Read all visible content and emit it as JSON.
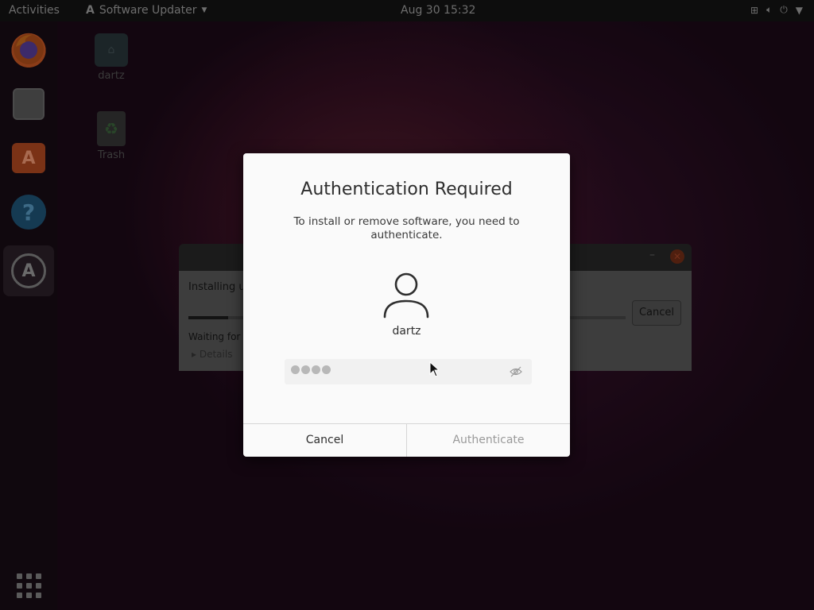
{
  "topbar": {
    "activities": "Activities",
    "app_name": "Software Updater",
    "clock": "Aug 30  15:32"
  },
  "desktop": {
    "home_label": "dartz",
    "trash_label": "Trash"
  },
  "background_window": {
    "installing_text": "Installing u",
    "waiting_text": "Waiting for",
    "details_label": "Details",
    "cancel_label": "Cancel",
    "progress": 0.09
  },
  "dialog": {
    "title": "Authentication Required",
    "message": "To install or remove software, you need to authenticate.",
    "username": "dartz",
    "password_masked_count": 4,
    "cancel_label": "Cancel",
    "authenticate_label": "Authenticate"
  },
  "icons": {
    "firefox": "firefox-icon",
    "files": "files-icon",
    "software": "software-center-icon",
    "help": "help-icon",
    "updater": "software-updater-icon",
    "apps": "show-applications-icon",
    "eye": "reveal-password-icon"
  }
}
